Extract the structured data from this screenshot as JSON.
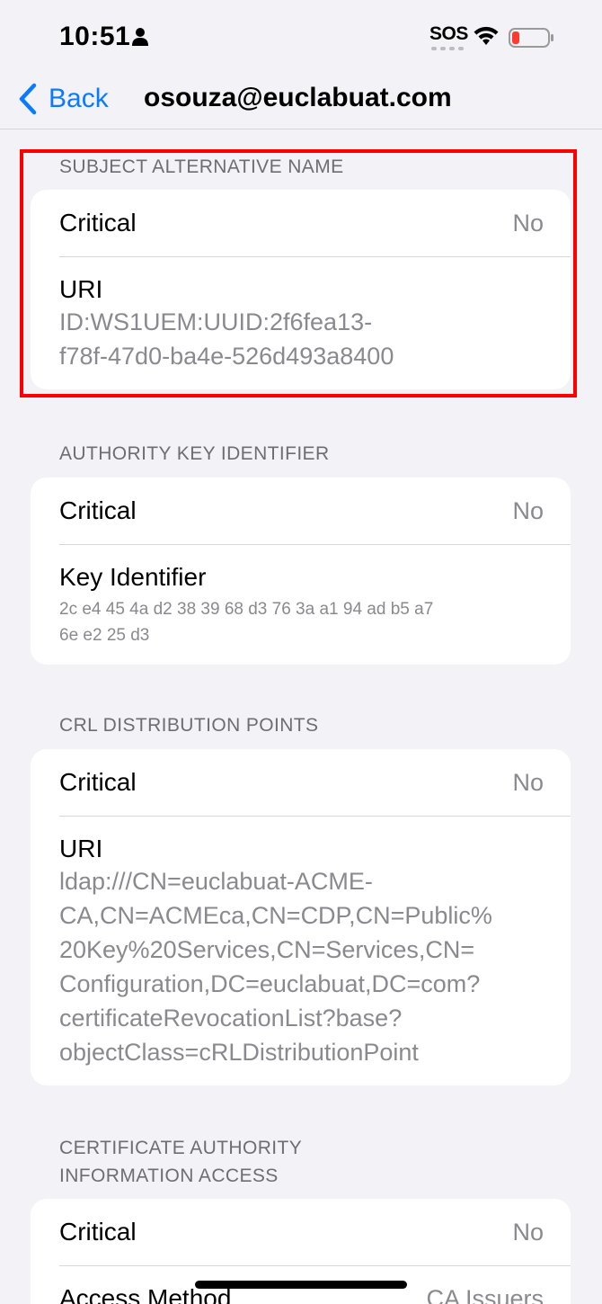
{
  "status_bar": {
    "time": "10:51",
    "sos": "SOS"
  },
  "nav": {
    "back_label": "Back",
    "title": "osouza@euclabuat.com"
  },
  "sections": [
    {
      "header": "SUBJECT ALTERNATIVE NAME",
      "rows": [
        {
          "label": "Critical",
          "value": "No"
        },
        {
          "label": "URI",
          "value_lines": [
            "ID:WS1UEM:UUID:2f6fea13-",
            "f78f-47d0-ba4e-526d493a8400"
          ]
        }
      ]
    },
    {
      "header": "AUTHORITY KEY IDENTIFIER",
      "rows": [
        {
          "label": "Critical",
          "value": "No"
        },
        {
          "label": "Key Identifier",
          "value_lines": [
            "2c e4 45 4a d2 38 39 68 d3 76 3a a1 94 ad b5 a7",
            "6e e2 25 d3"
          ]
        }
      ]
    },
    {
      "header": "CRL DISTRIBUTION POINTS",
      "rows": [
        {
          "label": "Critical",
          "value": "No"
        },
        {
          "label": "URI",
          "value_lines": [
            "ldap:///CN=euclabuat-ACME-",
            "CA,CN=ACMEca,CN=CDP,CN=Public%",
            "20Key%20Services,CN=Services,CN=",
            "Configuration,DC=euclabuat,DC=com?",
            "certificateRevocationList?base?",
            "objectClass=cRLDistributionPoint"
          ]
        }
      ]
    },
    {
      "header_lines": [
        "CERTIFICATE AUTHORITY",
        "INFORMATION ACCESS"
      ],
      "rows": [
        {
          "label": "Critical",
          "value": "No"
        },
        {
          "label": "Access Method",
          "value": "CA Issuers"
        }
      ]
    }
  ],
  "colors": {
    "accent": "#0a7aff",
    "highlight": "#ff0000",
    "background": "#f2f2f7",
    "secondary_text": "#8a8a8e"
  }
}
